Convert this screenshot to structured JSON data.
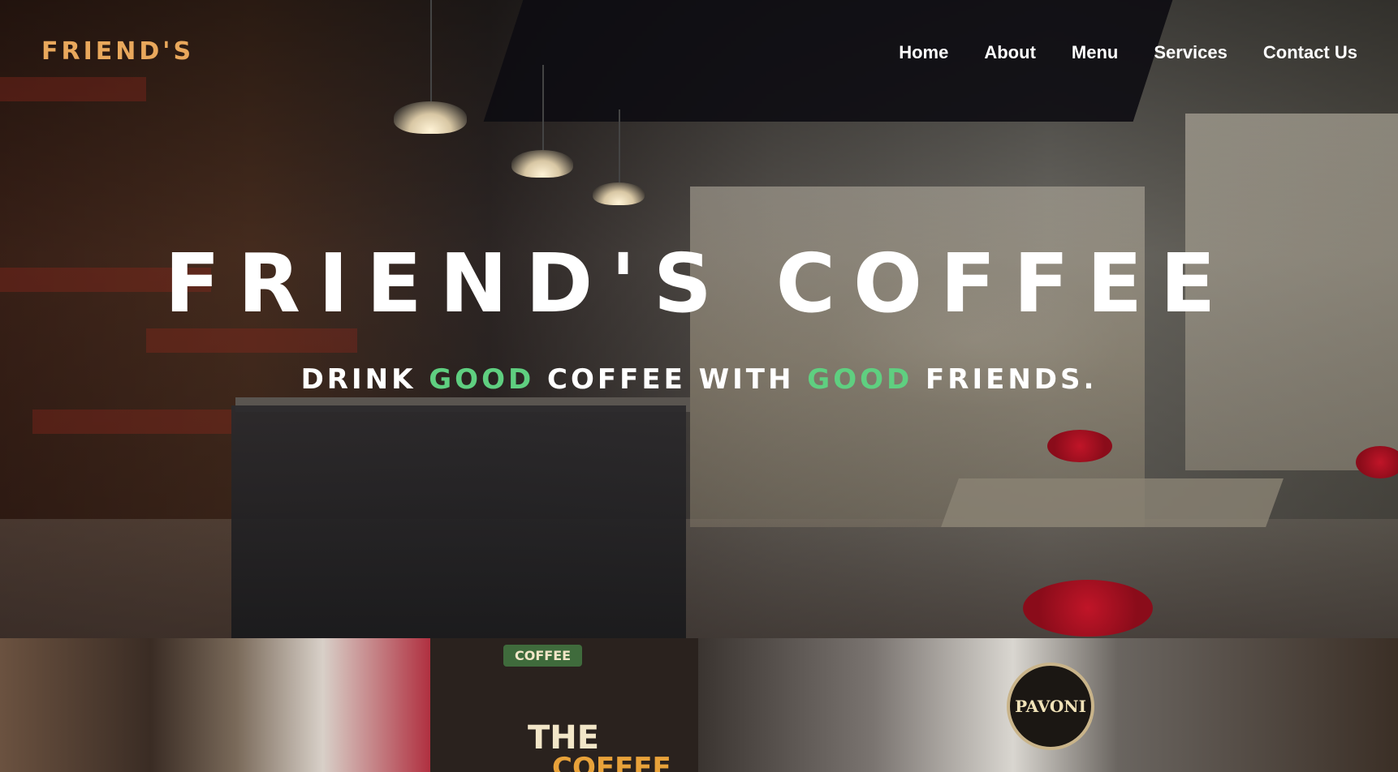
{
  "site": {
    "logo": "FRIEND'S"
  },
  "nav": {
    "items": [
      {
        "label": "Home"
      },
      {
        "label": "About"
      },
      {
        "label": "Menu"
      },
      {
        "label": "Services"
      },
      {
        "label": "Contact Us"
      }
    ]
  },
  "hero": {
    "title": "FRIEND'S COFFEE",
    "tagline": {
      "part1": "DRINK ",
      "highlight1": "GOOD",
      "part2": " COFFEE WITH ",
      "highlight2": "GOOD",
      "part3": " FRIENDS."
    }
  },
  "gallery": {
    "board_brand": "COFFEE",
    "board_line": "THE",
    "board_line2": "COFFEE",
    "machine_badge": "PAVONI"
  },
  "colors": {
    "logo": "#e9a85c",
    "accent_green": "#5fcf80",
    "nav_text": "#ffffff"
  }
}
